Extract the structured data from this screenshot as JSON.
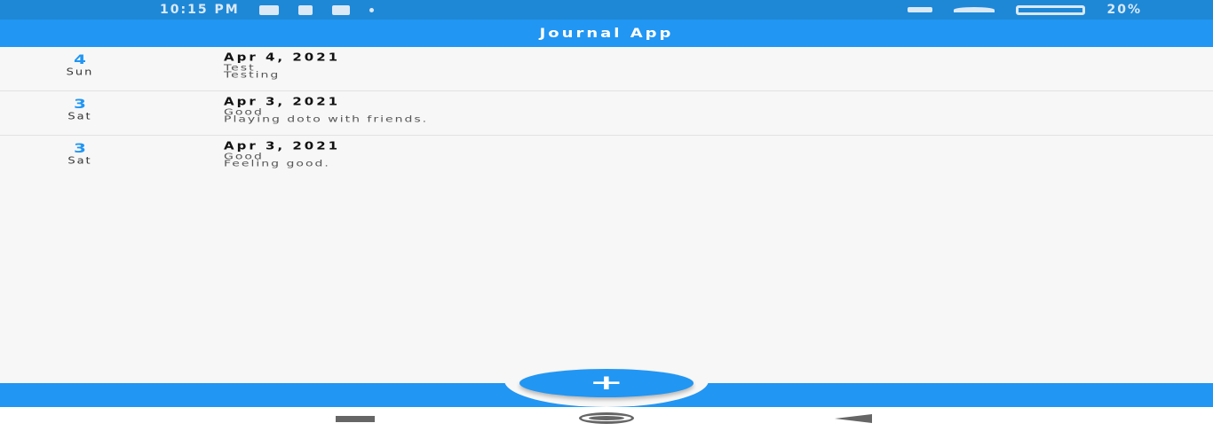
{
  "status_bar": {
    "time": "10:15 PM",
    "battery": "20%",
    "icons": [
      "message-icon",
      "calendar-icon",
      "grid-icon",
      "dot-icon",
      "signal-icon",
      "wifi-icon",
      "battery-icon"
    ]
  },
  "app_bar": {
    "title": "Journal App"
  },
  "entries": [
    {
      "day": "4",
      "weekday": "Sun",
      "date": "Apr 4, 2021",
      "title": "Test",
      "body": "Testing"
    },
    {
      "day": "3",
      "weekday": "Sat",
      "date": "Apr 3, 2021",
      "title": "Good",
      "body": "Playing doto with friends."
    },
    {
      "day": "3",
      "weekday": "Sat",
      "date": "Apr 3, 2021",
      "title": "Good",
      "body": "Feeling good."
    }
  ],
  "fab": {
    "icon": "plus-icon",
    "label": "+"
  },
  "nav": {
    "icons": [
      "recent-apps-icon",
      "home-icon",
      "back-icon"
    ]
  },
  "colors": {
    "primary": "#2196f3",
    "status_bar": "#1e88d6",
    "background": "#f7f7f7"
  }
}
